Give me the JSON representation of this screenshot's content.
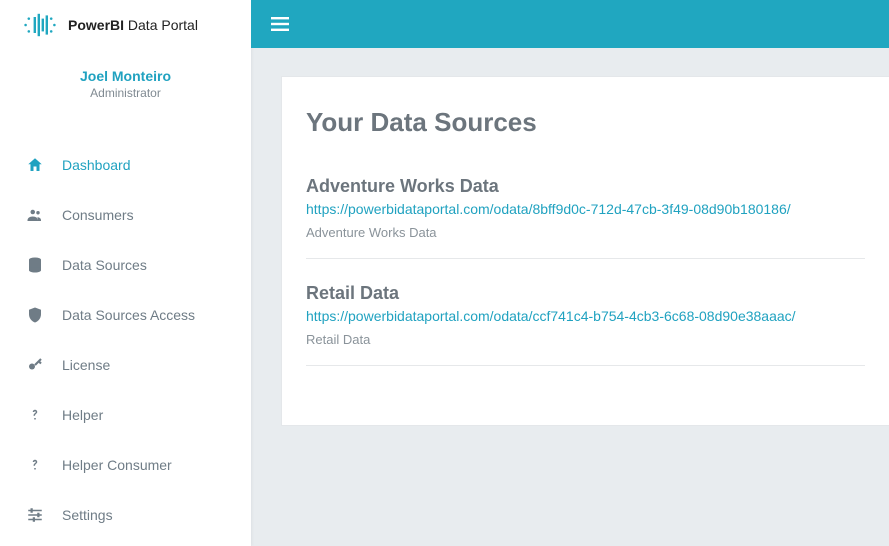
{
  "brand": {
    "bold": "PowerBI",
    "rest": " Data Portal"
  },
  "user": {
    "name": "Joel Monteiro",
    "role": "Administrator"
  },
  "nav": {
    "dashboard": "Dashboard",
    "consumers": "Consumers",
    "datasources": "Data Sources",
    "datasources_access": "Data Sources Access",
    "license": "License",
    "helper": "Helper",
    "helper_consumer": "Helper Consumer",
    "settings": "Settings"
  },
  "page": {
    "title": "Your Data Sources",
    "sources": [
      {
        "title": "Adventure Works Data",
        "url": "https://powerbidataportal.com/odata/8bff9d0c-712d-47cb-3f49-08d90b180186/",
        "sub": "Adventure Works Data"
      },
      {
        "title": "Retail Data",
        "url": "https://powerbidataportal.com/odata/ccf741c4-b754-4cb3-6c68-08d90e38aaac/",
        "sub": "Retail Data"
      }
    ]
  }
}
